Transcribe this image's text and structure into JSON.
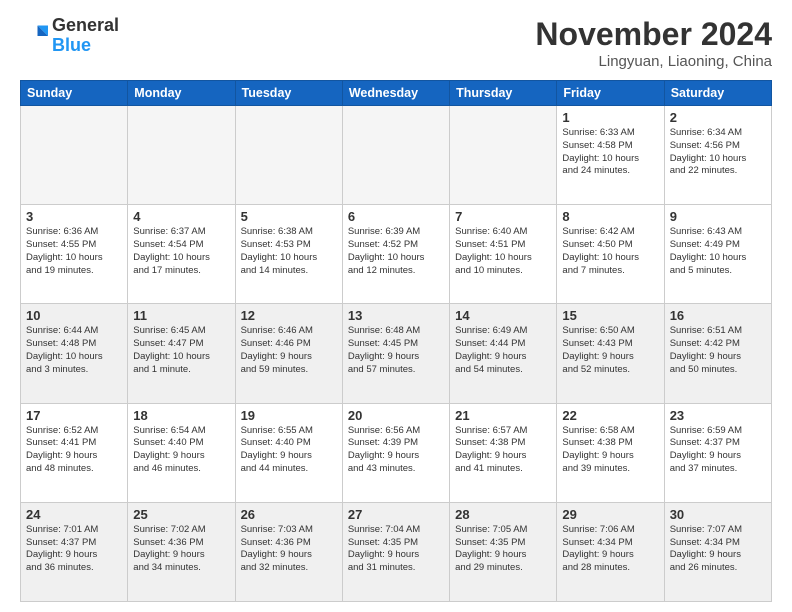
{
  "header": {
    "logo": {
      "general": "General",
      "blue": "Blue"
    },
    "title": "November 2024",
    "location": "Lingyuan, Liaoning, China"
  },
  "weekdays": [
    "Sunday",
    "Monday",
    "Tuesday",
    "Wednesday",
    "Thursday",
    "Friday",
    "Saturday"
  ],
  "weeks": [
    [
      {
        "day": "",
        "detail": "",
        "empty": true
      },
      {
        "day": "",
        "detail": "",
        "empty": true
      },
      {
        "day": "",
        "detail": "",
        "empty": true
      },
      {
        "day": "",
        "detail": "",
        "empty": true
      },
      {
        "day": "",
        "detail": "",
        "empty": true
      },
      {
        "day": "1",
        "detail": "Sunrise: 6:33 AM\nSunset: 4:58 PM\nDaylight: 10 hours\nand 24 minutes."
      },
      {
        "day": "2",
        "detail": "Sunrise: 6:34 AM\nSunset: 4:56 PM\nDaylight: 10 hours\nand 22 minutes."
      }
    ],
    [
      {
        "day": "3",
        "detail": "Sunrise: 6:36 AM\nSunset: 4:55 PM\nDaylight: 10 hours\nand 19 minutes."
      },
      {
        "day": "4",
        "detail": "Sunrise: 6:37 AM\nSunset: 4:54 PM\nDaylight: 10 hours\nand 17 minutes."
      },
      {
        "day": "5",
        "detail": "Sunrise: 6:38 AM\nSunset: 4:53 PM\nDaylight: 10 hours\nand 14 minutes."
      },
      {
        "day": "6",
        "detail": "Sunrise: 6:39 AM\nSunset: 4:52 PM\nDaylight: 10 hours\nand 12 minutes."
      },
      {
        "day": "7",
        "detail": "Sunrise: 6:40 AM\nSunset: 4:51 PM\nDaylight: 10 hours\nand 10 minutes."
      },
      {
        "day": "8",
        "detail": "Sunrise: 6:42 AM\nSunset: 4:50 PM\nDaylight: 10 hours\nand 7 minutes."
      },
      {
        "day": "9",
        "detail": "Sunrise: 6:43 AM\nSunset: 4:49 PM\nDaylight: 10 hours\nand 5 minutes."
      }
    ],
    [
      {
        "day": "10",
        "detail": "Sunrise: 6:44 AM\nSunset: 4:48 PM\nDaylight: 10 hours\nand 3 minutes.",
        "shaded": true
      },
      {
        "day": "11",
        "detail": "Sunrise: 6:45 AM\nSunset: 4:47 PM\nDaylight: 10 hours\nand 1 minute.",
        "shaded": true
      },
      {
        "day": "12",
        "detail": "Sunrise: 6:46 AM\nSunset: 4:46 PM\nDaylight: 9 hours\nand 59 minutes.",
        "shaded": true
      },
      {
        "day": "13",
        "detail": "Sunrise: 6:48 AM\nSunset: 4:45 PM\nDaylight: 9 hours\nand 57 minutes.",
        "shaded": true
      },
      {
        "day": "14",
        "detail": "Sunrise: 6:49 AM\nSunset: 4:44 PM\nDaylight: 9 hours\nand 54 minutes.",
        "shaded": true
      },
      {
        "day": "15",
        "detail": "Sunrise: 6:50 AM\nSunset: 4:43 PM\nDaylight: 9 hours\nand 52 minutes.",
        "shaded": true
      },
      {
        "day": "16",
        "detail": "Sunrise: 6:51 AM\nSunset: 4:42 PM\nDaylight: 9 hours\nand 50 minutes.",
        "shaded": true
      }
    ],
    [
      {
        "day": "17",
        "detail": "Sunrise: 6:52 AM\nSunset: 4:41 PM\nDaylight: 9 hours\nand 48 minutes."
      },
      {
        "day": "18",
        "detail": "Sunrise: 6:54 AM\nSunset: 4:40 PM\nDaylight: 9 hours\nand 46 minutes."
      },
      {
        "day": "19",
        "detail": "Sunrise: 6:55 AM\nSunset: 4:40 PM\nDaylight: 9 hours\nand 44 minutes."
      },
      {
        "day": "20",
        "detail": "Sunrise: 6:56 AM\nSunset: 4:39 PM\nDaylight: 9 hours\nand 43 minutes."
      },
      {
        "day": "21",
        "detail": "Sunrise: 6:57 AM\nSunset: 4:38 PM\nDaylight: 9 hours\nand 41 minutes."
      },
      {
        "day": "22",
        "detail": "Sunrise: 6:58 AM\nSunset: 4:38 PM\nDaylight: 9 hours\nand 39 minutes."
      },
      {
        "day": "23",
        "detail": "Sunrise: 6:59 AM\nSunset: 4:37 PM\nDaylight: 9 hours\nand 37 minutes."
      }
    ],
    [
      {
        "day": "24",
        "detail": "Sunrise: 7:01 AM\nSunset: 4:37 PM\nDaylight: 9 hours\nand 36 minutes.",
        "shaded": true
      },
      {
        "day": "25",
        "detail": "Sunrise: 7:02 AM\nSunset: 4:36 PM\nDaylight: 9 hours\nand 34 minutes.",
        "shaded": true
      },
      {
        "day": "26",
        "detail": "Sunrise: 7:03 AM\nSunset: 4:36 PM\nDaylight: 9 hours\nand 32 minutes.",
        "shaded": true
      },
      {
        "day": "27",
        "detail": "Sunrise: 7:04 AM\nSunset: 4:35 PM\nDaylight: 9 hours\nand 31 minutes.",
        "shaded": true
      },
      {
        "day": "28",
        "detail": "Sunrise: 7:05 AM\nSunset: 4:35 PM\nDaylight: 9 hours\nand 29 minutes.",
        "shaded": true
      },
      {
        "day": "29",
        "detail": "Sunrise: 7:06 AM\nSunset: 4:34 PM\nDaylight: 9 hours\nand 28 minutes.",
        "shaded": true
      },
      {
        "day": "30",
        "detail": "Sunrise: 7:07 AM\nSunset: 4:34 PM\nDaylight: 9 hours\nand 26 minutes.",
        "shaded": true
      }
    ]
  ]
}
